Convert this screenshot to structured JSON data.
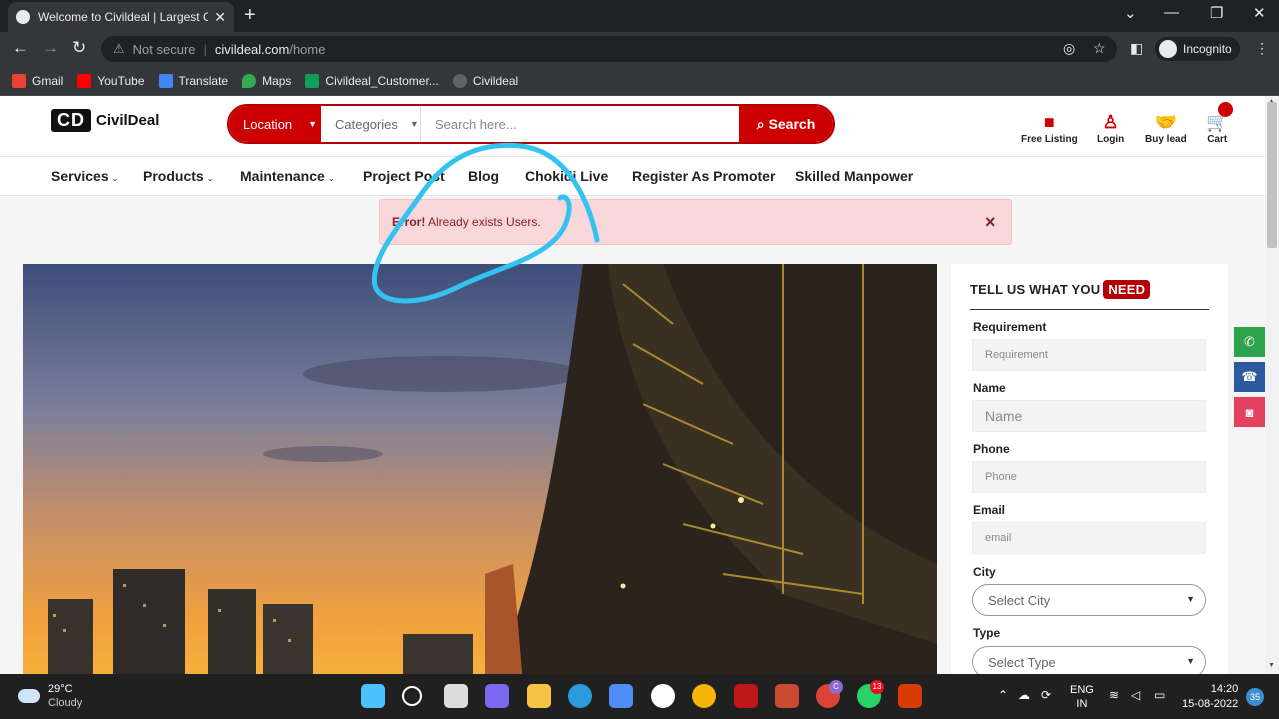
{
  "browser": {
    "tab_title": "Welcome to Civildeal | Largest O",
    "new_tab": "+",
    "address": {
      "warning": "Not secure",
      "host": "civildeal.com",
      "path": "/home"
    },
    "incognito_label": "Incognito",
    "bookmarks": [
      {
        "label": "Gmail",
        "icon": "gmail-icon",
        "color": "#ea4335"
      },
      {
        "label": "YouTube",
        "icon": "youtube-icon",
        "color": "#ff0000"
      },
      {
        "label": "Translate",
        "icon": "translate-icon",
        "color": "#4285f4"
      },
      {
        "label": "Maps",
        "icon": "maps-icon",
        "color": "#34a853"
      },
      {
        "label": "Civildeal_Customer...",
        "icon": "sheets-icon",
        "color": "#0f9d58"
      },
      {
        "label": "Civildeal",
        "icon": "globe-icon",
        "color": "#5f6368"
      }
    ]
  },
  "site": {
    "logo": {
      "mark": "CD",
      "name": "CivilDeal"
    },
    "search": {
      "location": "Location",
      "categories": "Categories",
      "placeholder": "Search here...",
      "button": "Search"
    },
    "header_icons": {
      "free_listing": "Free Listing",
      "login": "Login",
      "buy_lead": "Buy lead",
      "cart": "Cart"
    },
    "nav": [
      "Services",
      "Products",
      "Maintenance",
      "Project Post",
      "Blog",
      "Chokidi Live",
      "Register As Promoter",
      "Skilled Manpower"
    ],
    "alert": {
      "strong": "Error!",
      "message": "Already exists Users.",
      "close": "×"
    },
    "form": {
      "title": "TELL US WHAT YOU",
      "title_badge": "NEED",
      "requirement_label": "Requirement",
      "requirement_placeholder": "Requirement",
      "name_label": "Name",
      "name_placeholder": "Name",
      "phone_label": "Phone",
      "phone_placeholder": "Phone",
      "email_label": "Email",
      "email_placeholder": "email",
      "city_label": "City",
      "city_select": "Select City",
      "type_label": "Type",
      "type_select": "Select Type"
    },
    "social": [
      {
        "icon": "whatsapp-icon",
        "color": "#2ca44e"
      },
      {
        "icon": "phone-icon",
        "color": "#2c5aa0"
      },
      {
        "icon": "instagram-icon",
        "color": "#e4405f"
      }
    ]
  },
  "taskbar": {
    "weather": {
      "temp": "29°C",
      "condition": "Cloudy"
    },
    "language": {
      "lang": "ENG",
      "region": "IN"
    },
    "time": "14:20",
    "date": "15-08-2022",
    "notifications": "35",
    "badges": {
      "teams": "C",
      "whatsapp": "13"
    }
  },
  "colors": {
    "brand_red": "#c00000",
    "annotation": "#34c3f0"
  }
}
